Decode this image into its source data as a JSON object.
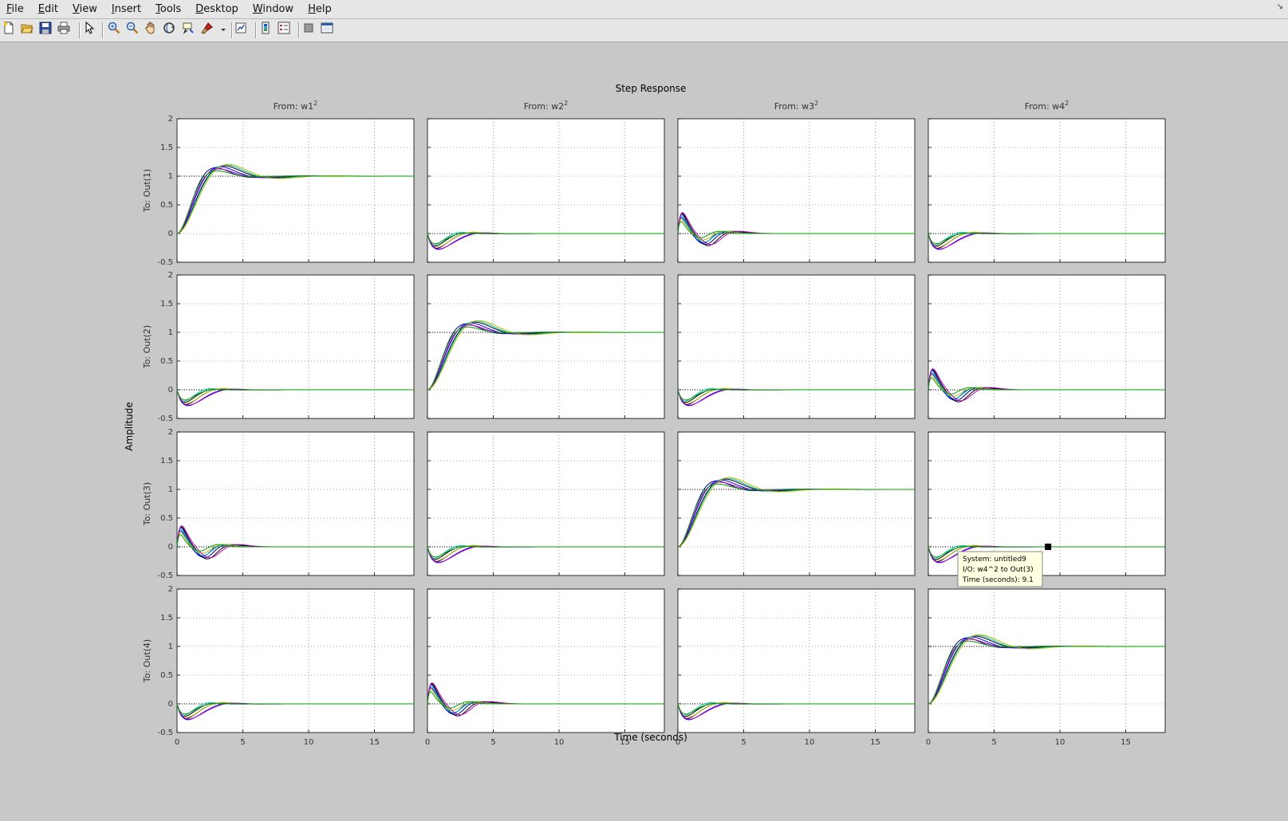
{
  "menubar": {
    "items": [
      {
        "key": "F",
        "rest": "ile"
      },
      {
        "key": "E",
        "rest": "dit"
      },
      {
        "key": "V",
        "rest": "iew"
      },
      {
        "key": "I",
        "rest": "nsert"
      },
      {
        "key": "T",
        "rest": "ools"
      },
      {
        "key": "D",
        "rest": "esktop"
      },
      {
        "key": "W",
        "rest": "indow"
      },
      {
        "key": "H",
        "rest": "elp"
      }
    ],
    "restore_glyph": "↘"
  },
  "toolbar": {
    "buttons": [
      "new-figure-icon",
      "open-file-icon",
      "save-icon",
      "print-icon",
      "pointer-icon",
      "zoom-in-icon",
      "zoom-out-icon",
      "pan-hand-icon",
      "rotate-3d-icon",
      "data-cursor-icon",
      "brush-icon",
      "link-plot-icon",
      "colorbar-icon",
      "legend-icon",
      "hide-plot-tools-icon",
      "show-plot-tools-icon"
    ]
  },
  "figure": {
    "title": "Step Response",
    "xlabel": "Time (seconds)",
    "ylabel": "Amplitude",
    "column_titles": [
      "From: w1",
      "From: w2",
      "From: w3",
      "From: w4"
    ],
    "column_superscript": "2",
    "row_labels": [
      "To: Out(1)",
      "To: Out(2)",
      "To: Out(3)",
      "To: Out(4)"
    ],
    "datatip": {
      "line1": "System: untitled9",
      "line2": "I/O: w4^2 to Out(3)",
      "line3": "Time (seconds): 9.1"
    }
  },
  "chart_data": {
    "type": "line",
    "layout": "4x4 subplot grid",
    "title": "Step Response",
    "xlabel": "Time (seconds)",
    "ylabel": "Amplitude",
    "xlim": [
      0,
      18
    ],
    "ylim": [
      -0.5,
      2
    ],
    "xticks": [
      0,
      5,
      10,
      15
    ],
    "yticks": [
      -0.5,
      0,
      0.5,
      1,
      1.5,
      2
    ],
    "grid": true,
    "series_colors": [
      "#00007f",
      "#0000ff",
      "#000000",
      "#00bfbf",
      "#bfbf00",
      "#bf00bf",
      "#00a000"
    ],
    "response_shapes": {
      "diagonal": {
        "final": 1,
        "peak": [
          1.24,
          1.3
        ],
        "peak_time": [
          2.2,
          3.5
        ]
      },
      "offdiag_neg": {
        "final": 0,
        "min": [
          -0.2,
          -0.28
        ],
        "min_time": [
          0.6,
          1.2
        ]
      },
      "offdiag_pos": {
        "final": 0,
        "initial_peak": [
          0.18,
          0.25
        ],
        "undershoot": [
          -0.1,
          -0.2
        ]
      }
    },
    "datatip": {
      "x": 9.1,
      "y": 0
    }
  },
  "colors": {
    "figure_bg": "#c8c8c8",
    "axes_bg": "#ffffff",
    "datatip_bg": "#ffffe1"
  }
}
